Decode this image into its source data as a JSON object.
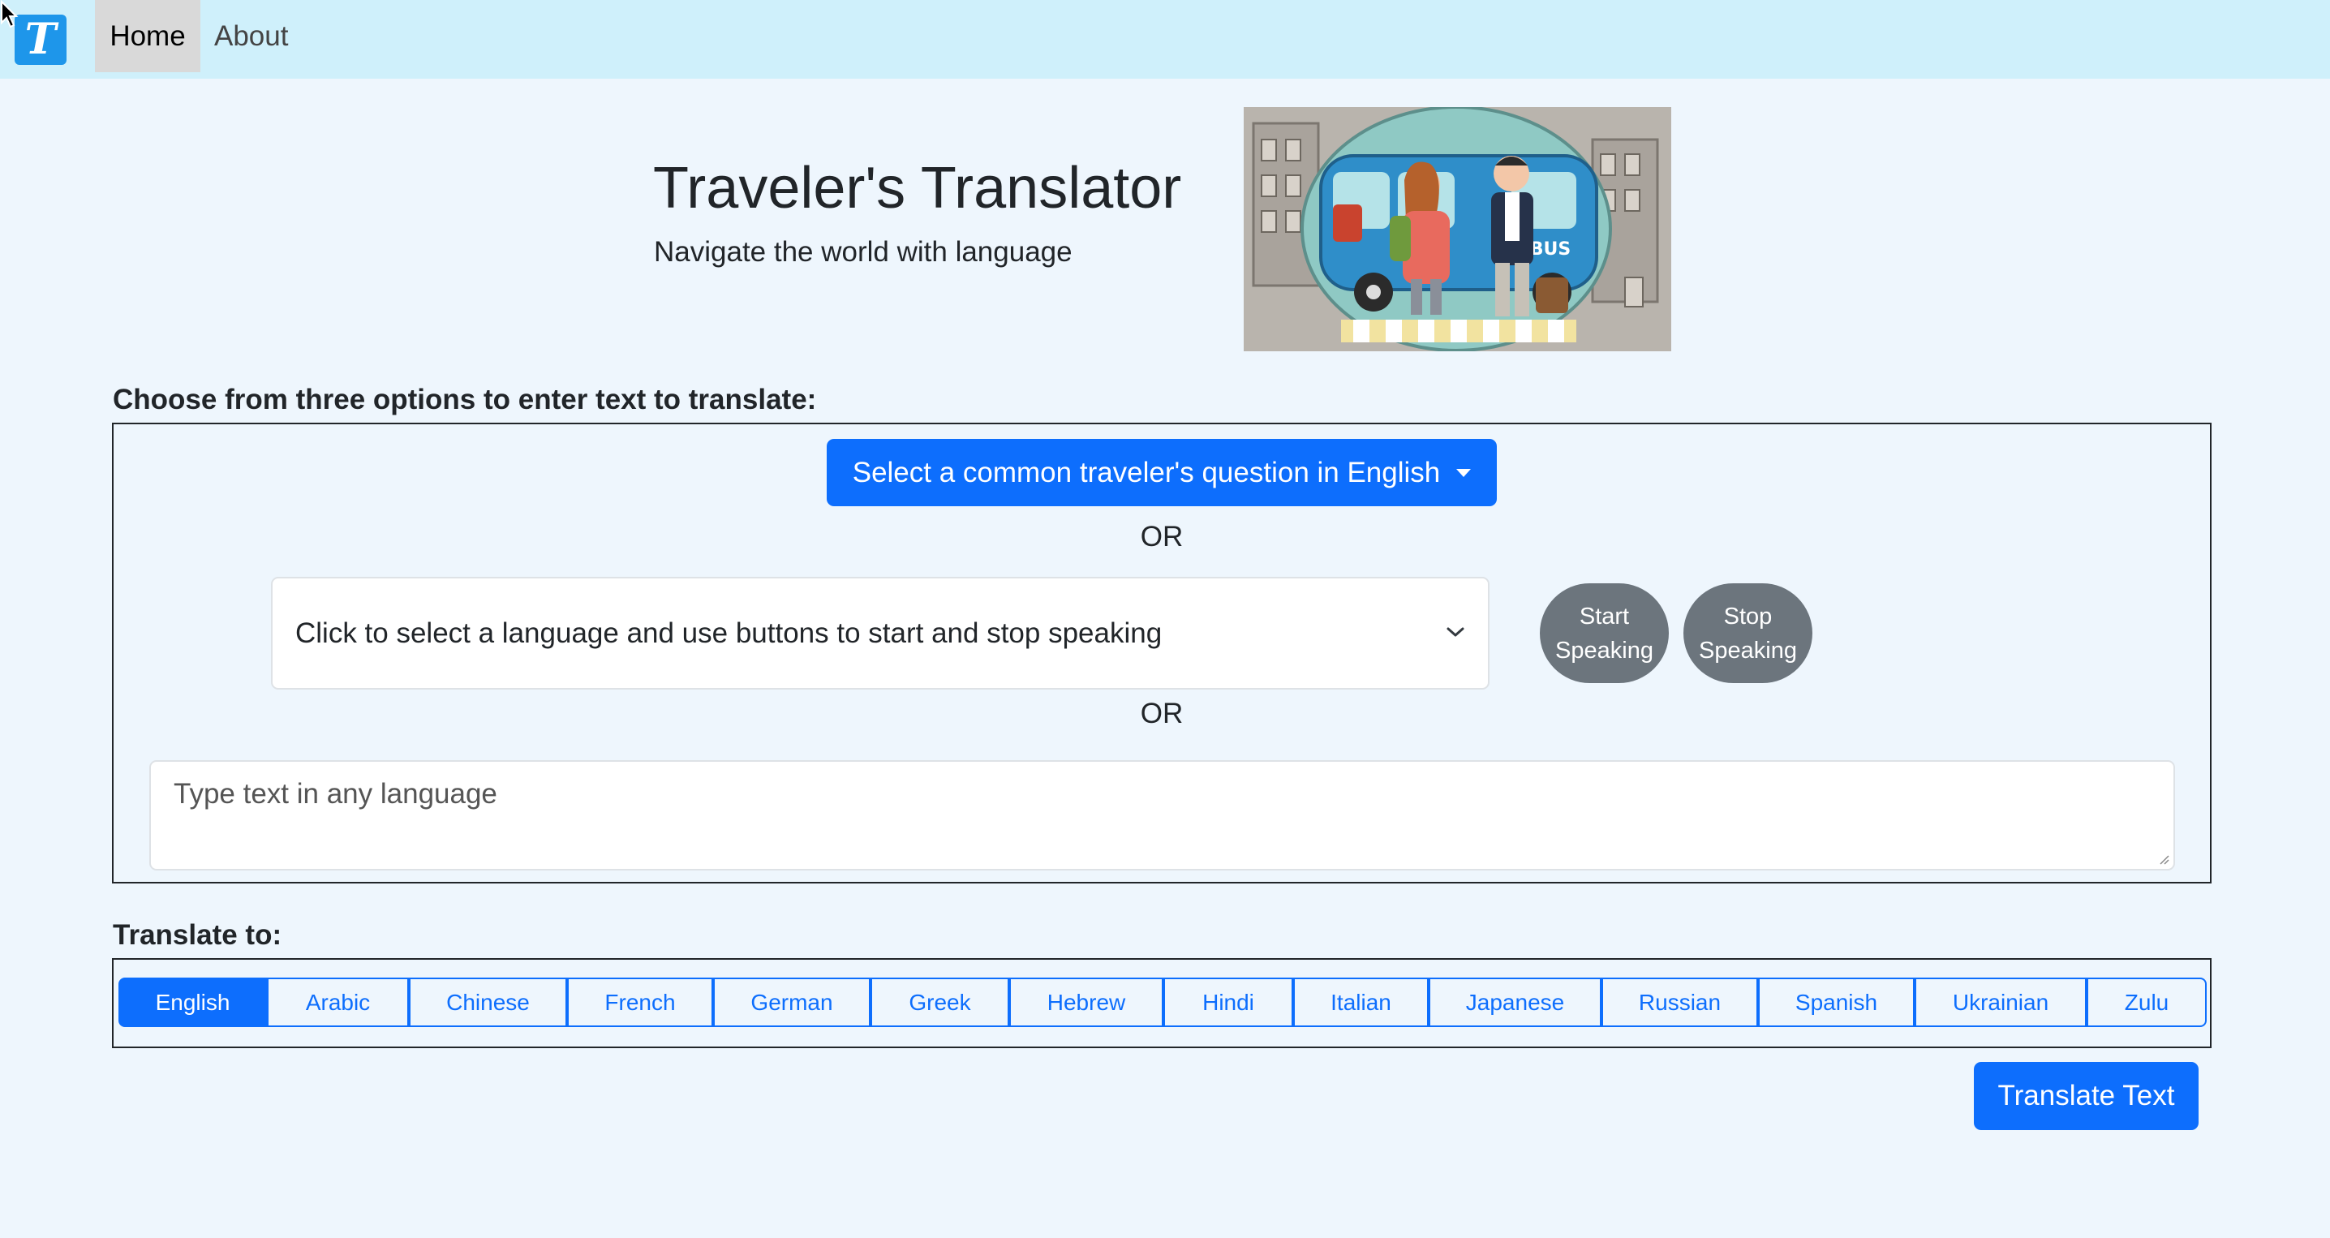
{
  "nav": {
    "logo_letter": "T",
    "items": [
      {
        "label": "Home",
        "active": true
      },
      {
        "label": "About",
        "active": false
      }
    ]
  },
  "header": {
    "title": "Traveler's Translator",
    "subtitle": "Navigate the world with language",
    "image_label": "BUS"
  },
  "input_section": {
    "label": "Choose from three options to enter text to translate:",
    "question_dropdown": "Select a common traveler's question in English",
    "or_label": "OR",
    "language_select": "Click to select a language and use buttons to start and stop speaking",
    "start_speaking": [
      "Start",
      "Speaking"
    ],
    "stop_speaking": [
      "Stop",
      "Speaking"
    ],
    "text_placeholder": "Type text in any language"
  },
  "translate_section": {
    "label": "Translate to:",
    "languages": [
      "English",
      "Arabic",
      "Chinese",
      "French",
      "German",
      "Greek",
      "Hebrew",
      "Hindi",
      "Italian",
      "Japanese",
      "Russian",
      "Spanish",
      "Ukrainian",
      "Zulu"
    ],
    "selected": "English",
    "translate_button": "Translate Text"
  },
  "colors": {
    "navbar_bg": "#cff0fb",
    "page_bg": "#eef6fd",
    "primary": "#0d6efd",
    "secondary": "#6c757d",
    "logo_bg": "#1e96ea"
  }
}
